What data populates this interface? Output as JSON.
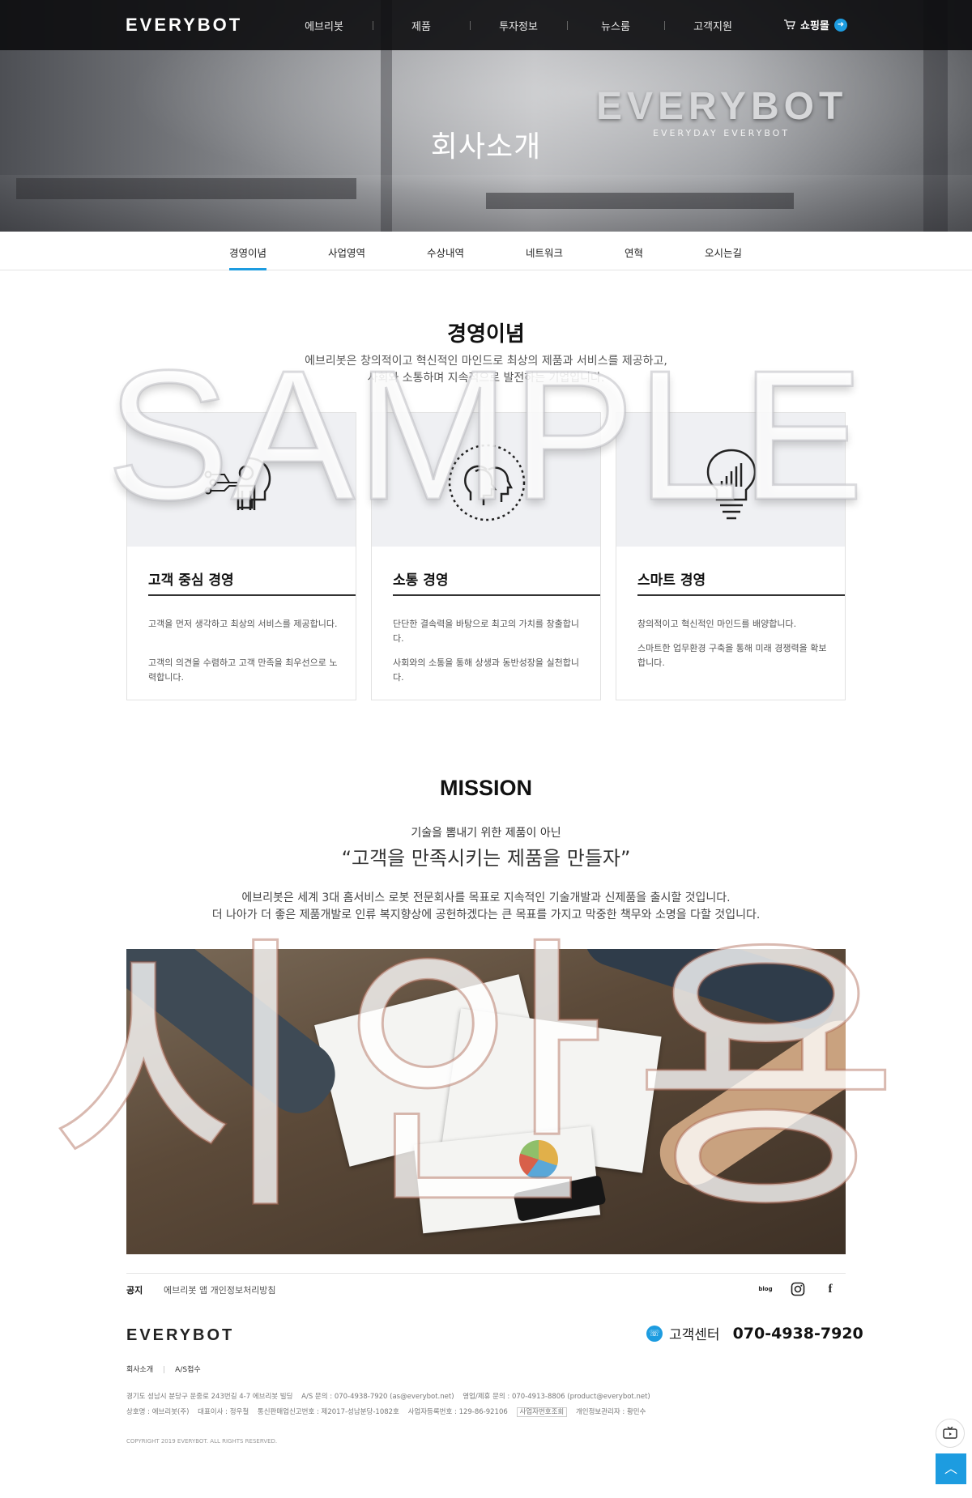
{
  "header": {
    "logo": "EVERYBOT",
    "nav": [
      "에브리봇",
      "제품",
      "투자정보",
      "뉴스룸",
      "고객지원"
    ],
    "shop_label": "쇼핑몰",
    "hero_title": "회사소개",
    "hero_brand": "EVERYBOT",
    "hero_slogan": "EVERYDAY EVERYBOT"
  },
  "subnav": {
    "tabs": [
      "경영이념",
      "사업영역",
      "수상내역",
      "네트워크",
      "연혁",
      "오시는길"
    ],
    "active": "경영이념"
  },
  "philosophy": {
    "title": "경영이념",
    "lead": [
      "에브리봇은 창의적이고 혁신적인 마인드로 최상의 제품과 서비스를 제공하고,",
      "사회와 소통하며 지속적으로 발전하는 기업입니다."
    ],
    "cards": [
      {
        "icon": "customer-focus-icon",
        "title": "고객 중심 경영",
        "desc": [
          "고객을 먼저 생각하고 최상의 서비스를 제공합니다.",
          "고객의 의견을 수렴하고 고객 만족을 최우선으로 노력합니다."
        ]
      },
      {
        "icon": "communication-icon",
        "title": "소통 경영",
        "desc": [
          "단단한 결속력을 바탕으로 최고의 가치를 창출합니다.",
          "사회와의 소통을 통해 상생과 동반성장을 실천합니다."
        ]
      },
      {
        "icon": "lightbulb-chart-icon",
        "title": "스마트 경영",
        "desc": [
          "창의적이고 혁신적인 마인드를 배양합니다.",
          "스마트한 업무환경 구축을 통해 미래 경쟁력을 확보합니다."
        ]
      }
    ]
  },
  "mission": {
    "title": "MISSION",
    "subtitle": "기술을 뽐내기 위한 제품이 아닌",
    "quote": "“고객을 만족시키는 제품을 만들자”",
    "body": [
      "에브리봇은 세계 3대 홈서비스 로봇 전문회사를 목표로 지속적인 기술개발과 신제품을 출시할 것입니다.",
      "더 나아가 더 좋은 제품개발로 인류 복지향상에 공헌하겠다는 큰 목표를 가지고 막중한 책무와 소명을 다할 것입니다."
    ]
  },
  "footer": {
    "notice_label": "공지",
    "notice_text": "에브리봇 앱 개인정보처리방침",
    "social": [
      "blog",
      "instagram-icon",
      "facebook-icon"
    ],
    "social_blog_label": "blog",
    "logo": "EVERYBOT",
    "cs_label": "고객센터",
    "cs_phone": "070-4938-7920",
    "links": [
      "회사소개",
      "A/S접수"
    ],
    "address_line": [
      "경기도 성남시 분당구 운중로 243번길 4-7 에브리봇 빌딩",
      "A/S 문의 : 070-4938-7920 (as@everybot.net)",
      "영업/제휴 문의 : 070-4913-8806 (product@everybot.net)"
    ],
    "company_line": [
      "상호명 : 에브리봇(주)",
      "대표이사 : 정우철",
      "통신판매업신고번호 : 제2017-성남분당-1082호",
      "사업자등록번호 : 129-86-92106",
      "사업자번호조회",
      "개인정보관리자 : 황민수"
    ],
    "copyright": "COPYRIGHT 2019 EVERYBOT. ALL RIGHTS RESERVED."
  },
  "watermarks": {
    "sample": "SAMPLE",
    "korean": "시안용"
  },
  "colors": {
    "accent": "#1d9ce0",
    "topbar": "#0c0c0e",
    "card_top": "#eff0f3"
  }
}
